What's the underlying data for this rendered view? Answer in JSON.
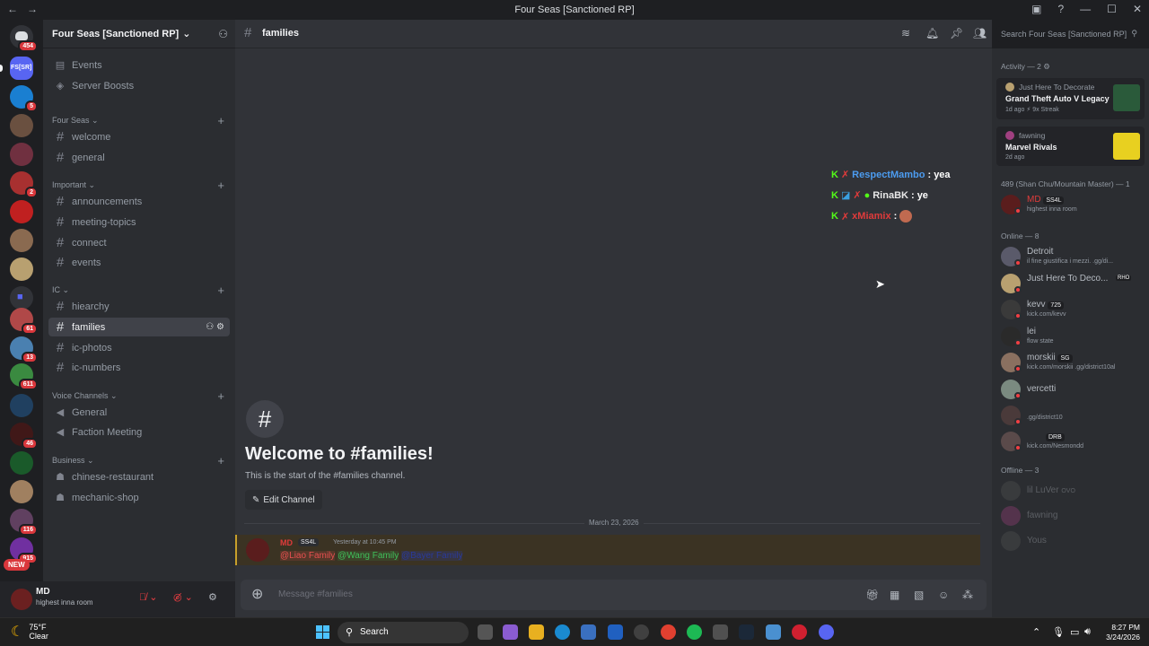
{
  "window": {
    "title": "Four Seas [Sanctioned RP]"
  },
  "server": {
    "name": "Four Seas [Sanctioned RP]",
    "dm_badge": "454",
    "acronym": "FS[SR]"
  },
  "guild_badges": {
    "g2": "5",
    "g5": "2",
    "g11": "61",
    "g12": "13",
    "g13": "611",
    "g15": "46",
    "g18": "116",
    "g19": "915",
    "new": "NEW"
  },
  "sidebar": {
    "events": "Events",
    "boosts": "Server Boosts",
    "cat_fourseas": "Four Seas",
    "welcome": "welcome",
    "general": "general",
    "cat_important": "Important",
    "announcements": "announcements",
    "meeting": "meeting-topics",
    "connect": "connect",
    "events_ch": "events",
    "cat_ic": "IC",
    "hiearchy": "hiearchy",
    "families": "families",
    "icphotos": "ic-photos",
    "icnumbers": "ic-numbers",
    "cat_voice": "Voice Channels",
    "v_general": "General",
    "v_faction": "Faction Meeting",
    "cat_business": "Business",
    "chinese": "chinese-restaurant",
    "mechanic": "mechanic-shop"
  },
  "user": {
    "name": "MD",
    "status": "highest inna room"
  },
  "channel": {
    "name": "families"
  },
  "overlay": [
    {
      "name": "RespectMambo",
      "text": ": yea",
      "color": "#4c9cf0"
    },
    {
      "name": "RinaBK",
      "text": ": ye",
      "color": "#e8e8e8"
    },
    {
      "name": "xMiamix",
      "text": ":",
      "color": "#e03b3b"
    }
  ],
  "welcome": {
    "title": "Welcome to #families!",
    "subtitle": "This is the start of the #families channel.",
    "edit": "Edit Channel"
  },
  "date_divider": "March 23, 2026",
  "message": {
    "author": "MD",
    "tag": "SS4L",
    "time": "Yesterday at 10:45 PM",
    "m1": "@Liao Family",
    "m2": "@Wang Family",
    "m3": "@Bayer Family"
  },
  "composer": {
    "placeholder": "Message #families"
  },
  "search": {
    "placeholder": "Search Four Seas [Sanctioned RP]"
  },
  "members": {
    "activity_header": "Activity — 2",
    "act1": {
      "pre": "Just Here To Decorate",
      "game": "Grand Theft Auto V Legacy",
      "meta": "1d ago  ⚡ 9x Streak"
    },
    "act2": {
      "pre": "fawning",
      "game": "Marvel Rivals",
      "meta": "2d ago"
    },
    "role_header": "489 (Shan Chu/Mountain Master) — 1",
    "md": {
      "name": "MD",
      "tag": "SS4L",
      "sub": "highest inna room"
    },
    "online_header": "Online — 8",
    "online": [
      {
        "name": "Detroit",
        "sub": "il fine giustifica i mezzi. .gg/di..."
      },
      {
        "name": "Just Here To Deco...",
        "sub": "RHO"
      },
      {
        "name": "kevv",
        "sub": "kick.com/kevv",
        "tag": "725"
      },
      {
        "name": "lei",
        "sub": "flow state"
      },
      {
        "name": "morskii",
        "sub": "kick.com/morskii .gg/district10al",
        "tag": "SG"
      },
      {
        "name": "vercetti",
        "sub": ""
      },
      {
        "name": "",
        "sub": ".gg/district10"
      },
      {
        "name": "",
        "sub": "kick.com/Nesmondd",
        "tag": "DRB"
      }
    ],
    "offline_header": "Offline — 3",
    "offline": [
      {
        "name": "lil LuVer",
        "tag": "OVO"
      },
      {
        "name": "fawning"
      },
      {
        "name": "Yous"
      }
    ]
  },
  "taskbar": {
    "temp": "75°F",
    "cond": "Clear",
    "search": "Search",
    "time": "8:27 PM",
    "date": "3/24/2026"
  }
}
